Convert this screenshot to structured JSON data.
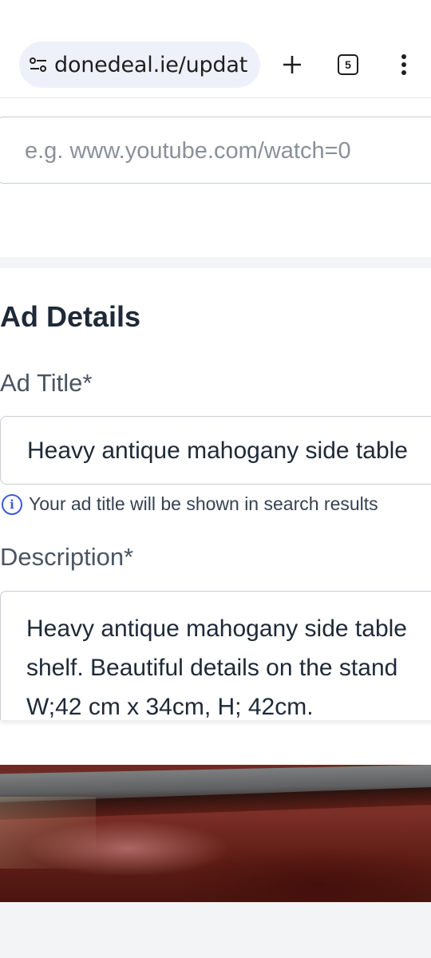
{
  "browser": {
    "url": "donedeal.ie/updat",
    "tab_count": "5",
    "icons": {
      "site_info": "site-settings-icon",
      "new_tab": "plus-icon",
      "tabs": "tab-switcher-icon",
      "menu": "more-vert-icon"
    }
  },
  "video": {
    "placeholder": "e.g. www.youtube.com/watch=0"
  },
  "ad_details": {
    "section_title": "Ad Details",
    "title_label": "Ad Title*",
    "title_value": "Heavy antique mahogany side table",
    "title_hint": "Your ad title will be shown in search results",
    "description_label": "Description*",
    "description_lines": [
      "Heavy antique mahogany side table",
      "shelf.  Beautiful details on the stand",
      "W;42 cm x 34cm, H; 42cm."
    ]
  },
  "colors": {
    "info_accent": "#3b5bdb",
    "url_bar_bg": "#eef0fa",
    "border": "#c9cdd3"
  }
}
